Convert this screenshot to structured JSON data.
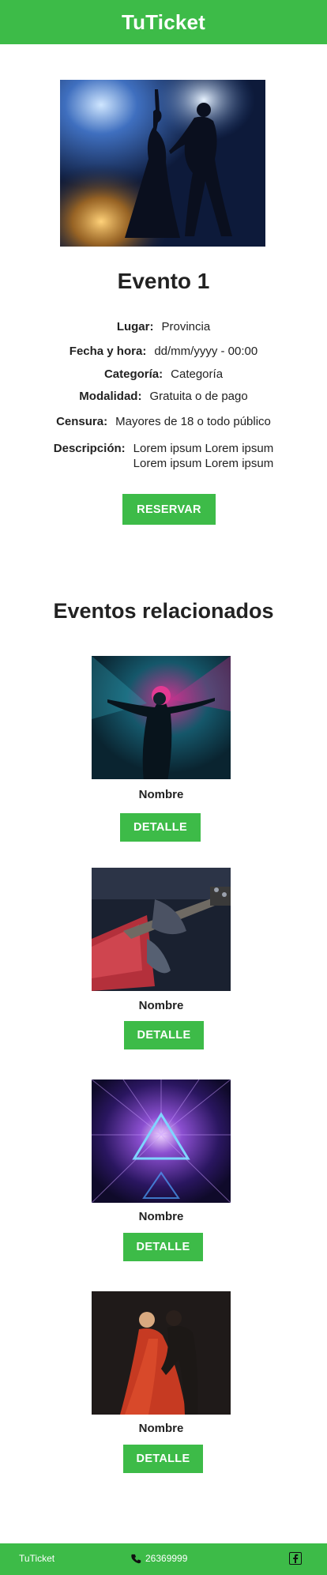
{
  "header": {
    "brand": "TuTicket"
  },
  "event": {
    "title": "Evento 1",
    "hero_image": "couple-dancing-stage-photo",
    "details": [
      {
        "label": "Lugar:",
        "value": "Provincia"
      },
      {
        "label": "Fecha y hora:",
        "value": "dd/mm/yyyy - 00:00"
      },
      {
        "label": "Categoría:",
        "value": "Categoría"
      },
      {
        "label": "Modalidad:",
        "value": "Gratuita o de pago"
      },
      {
        "label": "Censura:",
        "value": "Mayores de 18 o todo público"
      },
      {
        "label": "Descripción:",
        "value_lines": [
          "Lorem ipsum Lorem ipsum",
          "Lorem ipsum Lorem ipsum"
        ]
      }
    ],
    "reserve_label": "RESERVAR"
  },
  "related": {
    "title": "Eventos relacionados",
    "cards": [
      {
        "image": "neon-dancer-photo",
        "name": "Nombre",
        "button": "DETALLE"
      },
      {
        "image": "guitar-player-photo",
        "name": "Nombre",
        "button": "DETALLE"
      },
      {
        "image": "neon-triangle-tunnel-photo",
        "name": "Nombre",
        "button": "DETALLE"
      },
      {
        "image": "red-dress-dancers-photo",
        "name": "Nombre",
        "button": "DETALLE"
      }
    ]
  },
  "footer": {
    "brand": "TuTicket",
    "phone": "26369999",
    "phone_icon": "phone-icon",
    "social_icon": "facebook-icon"
  },
  "colors": {
    "brand_green": "#3dbb48",
    "text_dark": "#222222"
  }
}
